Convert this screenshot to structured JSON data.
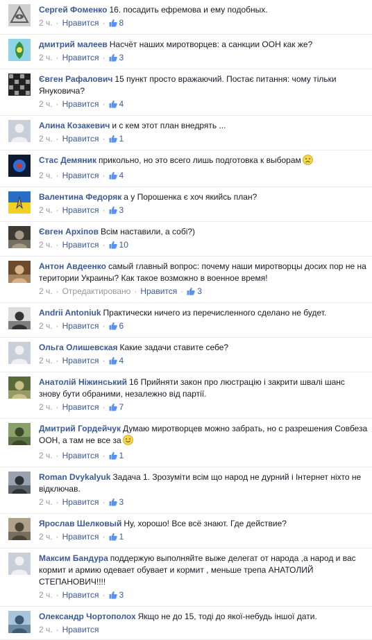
{
  "like_label": "Нравится",
  "separator": "·",
  "colors": {
    "link": "#3b5998",
    "meta": "#9197a3",
    "text": "#141823",
    "divider": "#e9eaed"
  },
  "comments": [
    {
      "author": "Сергей Фоменко",
      "text": "16. посадить ефремова и ему подобных.",
      "time": "2 ч.",
      "likes": "8",
      "avatar": "avatar-eye-logo",
      "avatar_colors": [
        "#cfcfcf",
        "#5a5a5a"
      ]
    },
    {
      "author": "дмитрий малеев",
      "text": "Насчёт наших миротворцев: а санкции ООН как же?",
      "time": "2 ч.",
      "likes": "3",
      "avatar": "avatar-green-emblem",
      "avatar_colors": [
        "#8fd3e6",
        "#3a8f3a"
      ]
    },
    {
      "author": "Євген Рафалович",
      "text": "15 пункт просто вражаючий. Постає питання: чому тільки Януковича?",
      "time": "2 ч.",
      "likes": "4",
      "avatar": "avatar-mosaic",
      "avatar_colors": [
        "#222222",
        "#9a9a9a"
      ]
    },
    {
      "author": "Алина Козакевич",
      "text": "и с кем этот план внедрять ...",
      "time": "2 ч.",
      "likes": "1",
      "avatar": "avatar-default",
      "avatar_colors": [
        "#c9cfd9",
        "#eef0f4"
      ]
    },
    {
      "author": "Стас Демяник",
      "text": "прикольно, но это всего лишь подготовка к выборам",
      "emoji": "frown",
      "time": "2 ч.",
      "likes": "4",
      "avatar": "avatar-dark-blue",
      "avatar_colors": [
        "#0d1a33",
        "#2d6fd6"
      ]
    },
    {
      "author": "Валентина Федоряк",
      "text": "а у Порошенка є хоч якийсь план?",
      "time": "2 ч.",
      "likes": "3",
      "avatar": "avatar-ukraine-flag",
      "avatar_colors": [
        "#2b6cc4",
        "#f2d024"
      ]
    },
    {
      "author": "Євген Архіпов",
      "text": "Всім наставили, а собі?)",
      "time": "2 ч.",
      "likes": "10",
      "avatar": "avatar-photo-dark",
      "avatar_colors": [
        "#3d3a34",
        "#a59b86"
      ]
    },
    {
      "author": "Антон Авдеенко",
      "text": "самый главный вопрос: почему наши миротворцы досих пор не на територии Украины? Как такое возможно в военное время!",
      "time": "2 ч.",
      "edited": "Отредактировано",
      "likes": "3",
      "avatar": "avatar-photo-warm",
      "avatar_colors": [
        "#6b4a2e",
        "#d9b48a"
      ]
    },
    {
      "author": "Andrii Antoniuk",
      "text": "Практически ничего из перечисленного сделано не будет.",
      "time": "2 ч.",
      "likes": "6",
      "avatar": "avatar-photo-bw",
      "avatar_colors": [
        "#dcdcdc",
        "#333333"
      ]
    },
    {
      "author": "Ольга Олишевская",
      "text": "Какие задачи ставите себе?",
      "time": "2 ч.",
      "likes": "4",
      "avatar": "avatar-default",
      "avatar_colors": [
        "#c9cfd9",
        "#eef0f4"
      ]
    },
    {
      "author": "Анатолій Ніжинський",
      "text": "16 Прийняти закон про люстрацію і закрити швалі шанс знову бути обраними, незалежно від партії.",
      "time": "2 ч.",
      "likes": "7",
      "avatar": "avatar-photo-green",
      "avatar_colors": [
        "#5b6a3a",
        "#c9c08a"
      ]
    },
    {
      "author": "Дмитрий Гордейчук",
      "text": "Думаю миротворцев можно забрать, но с разрешения Совбеза ООН, а там не все за",
      "emoji": "smile",
      "time": "2 ч.",
      "likes": "1",
      "avatar": "avatar-photo-outdoor",
      "avatar_colors": [
        "#8aa06a",
        "#3c4a2a"
      ]
    },
    {
      "author": "Roman Dvykalyuk",
      "text": "Задача 1. Зрозуміти всім що народ не дурний і Інтернет ніхто не відключав.",
      "time": "2 ч.",
      "likes": "3",
      "avatar": "avatar-photo-suit",
      "avatar_colors": [
        "#9aa3ad",
        "#2d3138"
      ]
    },
    {
      "author": "Ярослав Шелковый",
      "text": "Ну, хорошо! Все всё знают. Где действие?",
      "time": "2 ч.",
      "likes": "1",
      "avatar": "avatar-photo-landscape",
      "avatar_colors": [
        "#b0a28a",
        "#4a4438"
      ]
    },
    {
      "author": "Максим Бандура",
      "text": "поддержую выполняйте выже делегат от народа ,а народ и вас кормит и армию одевает обувает и кормит , меньше трепа АНАТОЛИЙ СТЕПАНОВИЧ!!!!",
      "time": "2 ч.",
      "likes": "3",
      "avatar": "avatar-default",
      "avatar_colors": [
        "#c9cfd9",
        "#eef0f4"
      ]
    },
    {
      "author": "Олександр Чортополох",
      "text": "Якщо не до 15, тоді до якої-небудь іншої дати.",
      "time": "2 ч.",
      "likes": "",
      "avatar": "avatar-photo-sky",
      "avatar_colors": [
        "#a9c4dc",
        "#3e5a73"
      ]
    }
  ]
}
